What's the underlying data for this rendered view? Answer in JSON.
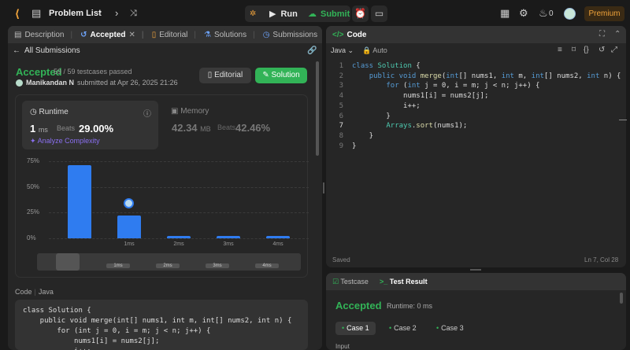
{
  "topbar": {
    "title": "Problem List",
    "run_label": "Run",
    "submit_label": "Submit",
    "streak_count": "0",
    "premium_label": "Premium"
  },
  "left_tabs": [
    "Description",
    "Accepted",
    "Editorial",
    "Solutions",
    "Submissions"
  ],
  "submission": {
    "back_label": "All Submissions",
    "status": "Accepted",
    "testcases": "59 / 59 testcases passed",
    "author": "Manikandan N",
    "submitted_at": "submitted at Apr 26, 2025 21:26",
    "editorial_button": "Editorial",
    "solution_button": "Solution"
  },
  "runtime": {
    "title": "Runtime",
    "value": "1",
    "unit": "ms",
    "beats_label": "Beats",
    "beats_value": "29.00%",
    "analyze_label": "Analyze Complexity"
  },
  "memory": {
    "title": "Memory",
    "value": "42.34",
    "unit": "MB",
    "beats_label": "Beats",
    "beats_value": "42.46%"
  },
  "chart_data": {
    "type": "bar",
    "y_ticks": [
      "75%",
      "50%",
      "25%",
      "0%"
    ],
    "ylim": [
      0,
      75
    ],
    "categories": [
      "",
      "1ms",
      "2ms",
      "3ms",
      "4ms"
    ],
    "values": [
      71,
      22,
      2,
      2,
      2
    ],
    "selected_category": "1ms",
    "accent": "#2f7cf0"
  },
  "scrubber_labels": [
    "1ms",
    "2ms",
    "3ms",
    "4ms"
  ],
  "code_section": {
    "label": "Code",
    "language": "Java",
    "lines": [
      "class Solution {",
      "    public void merge(int[] nums1, int m, int[] nums2, int n) {",
      "        for (int j = 0, i = m; j < n; j++) {",
      "            nums1[i] = nums2[j];",
      "            i++;"
    ]
  },
  "editor": {
    "tab_title": "Code",
    "language": "Java",
    "mode": "Auto",
    "saved_label": "Saved",
    "cursor_position": "Ln 7, Col 28",
    "line_numbers": [
      "1",
      "2",
      "3",
      "4",
      "5",
      "6",
      "7",
      "8",
      "9"
    ]
  },
  "bottom_panel": {
    "testcase_tab": "Testcase",
    "result_tab": "Test Result",
    "status": "Accepted",
    "runtime": "Runtime: 0 ms",
    "cases": [
      "Case 1",
      "Case 2",
      "Case 3"
    ],
    "input_label": "Input"
  },
  "colors": {
    "accepted_green": "#32b357",
    "premium_orange": "#f0a33b",
    "bar_blue": "#2f7cf0"
  }
}
